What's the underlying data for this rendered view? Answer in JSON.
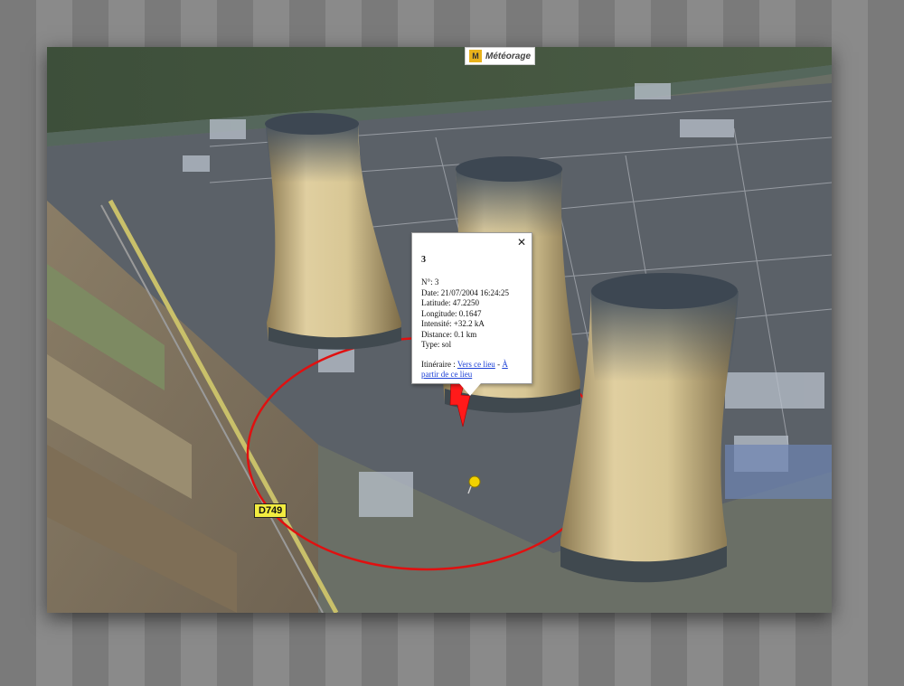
{
  "logo": {
    "text": "Météorage",
    "icon": "meteorage-logo-icon"
  },
  "road_label": "D749",
  "popup": {
    "title": "3",
    "number": "N°: 3",
    "date": "Date: 21/07/2004 16:24:25",
    "latitude": "Latitude: 47.2250",
    "longitude": "Longitude: 0.1647",
    "intensity": "Intensité: +32.2 kA",
    "distance": "Distance: 0.1 km",
    "type": "Type: sol",
    "itinerary_prefix": "Itinéraire : ",
    "link_to": "Vers ce lieu",
    "separator": " - ",
    "link_from": "À partir de ce lieu",
    "close_icon": "close-icon"
  },
  "markers": {
    "lightning_icon": "lightning-bolt-icon",
    "pin_icon": "push-pin-icon"
  },
  "colors": {
    "circle": "#e01010",
    "lightning": "#ff1a1a",
    "pin": "#f2d200",
    "link": "#1a3fd6"
  }
}
